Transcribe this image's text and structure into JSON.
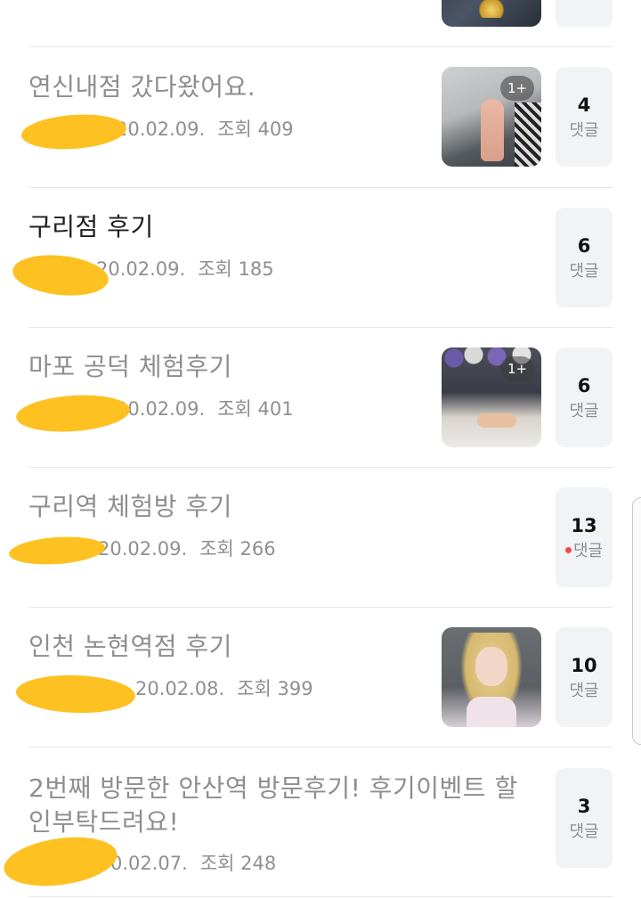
{
  "posts": [
    {
      "title": "연신내점 갔다왔어요.",
      "read": true,
      "date": "20.02.09.",
      "views": "조회 409",
      "thumbnail": true,
      "image_badge": "1+",
      "comment_count": "4",
      "comment_label": "댓글"
    },
    {
      "title": "구리점 후기",
      "read": false,
      "date": "20.02.09.",
      "views": "조회 185",
      "thumbnail": false,
      "comment_count": "6",
      "comment_label": "댓글"
    },
    {
      "title": "마포 공덕 체험후기",
      "read": true,
      "date": "20.02.09.",
      "views": "조회 401",
      "thumbnail": true,
      "image_badge": "1+",
      "comment_count": "6",
      "comment_label": "댓글"
    },
    {
      "title": "구리역 체험방 후기",
      "read": true,
      "date": "20.02.09.",
      "views": "조회 266",
      "thumbnail": false,
      "comment_count": "13",
      "comment_label": "댓글",
      "new_comment": true
    },
    {
      "title": "인천 논현역점 후기",
      "read": true,
      "date": "20.02.08.",
      "views": "조회 399",
      "thumbnail": true,
      "comment_count": "10",
      "comment_label": "댓글"
    },
    {
      "title": "2번째 방문한 안산역 방문후기! 후기이벤트 할인부탁드려요!",
      "read": true,
      "date": "0.02.07.",
      "views": "조회 248",
      "thumbnail": false,
      "comment_count": "3",
      "comment_label": "댓글"
    }
  ],
  "colors": {
    "read_title": "#8e8e8e",
    "unread_title": "#1f1f1f",
    "meta": "#8f8f8f",
    "comment_box": "#f2f3f5",
    "new_dot": "#f04a4a",
    "redaction": "#fdc121"
  }
}
